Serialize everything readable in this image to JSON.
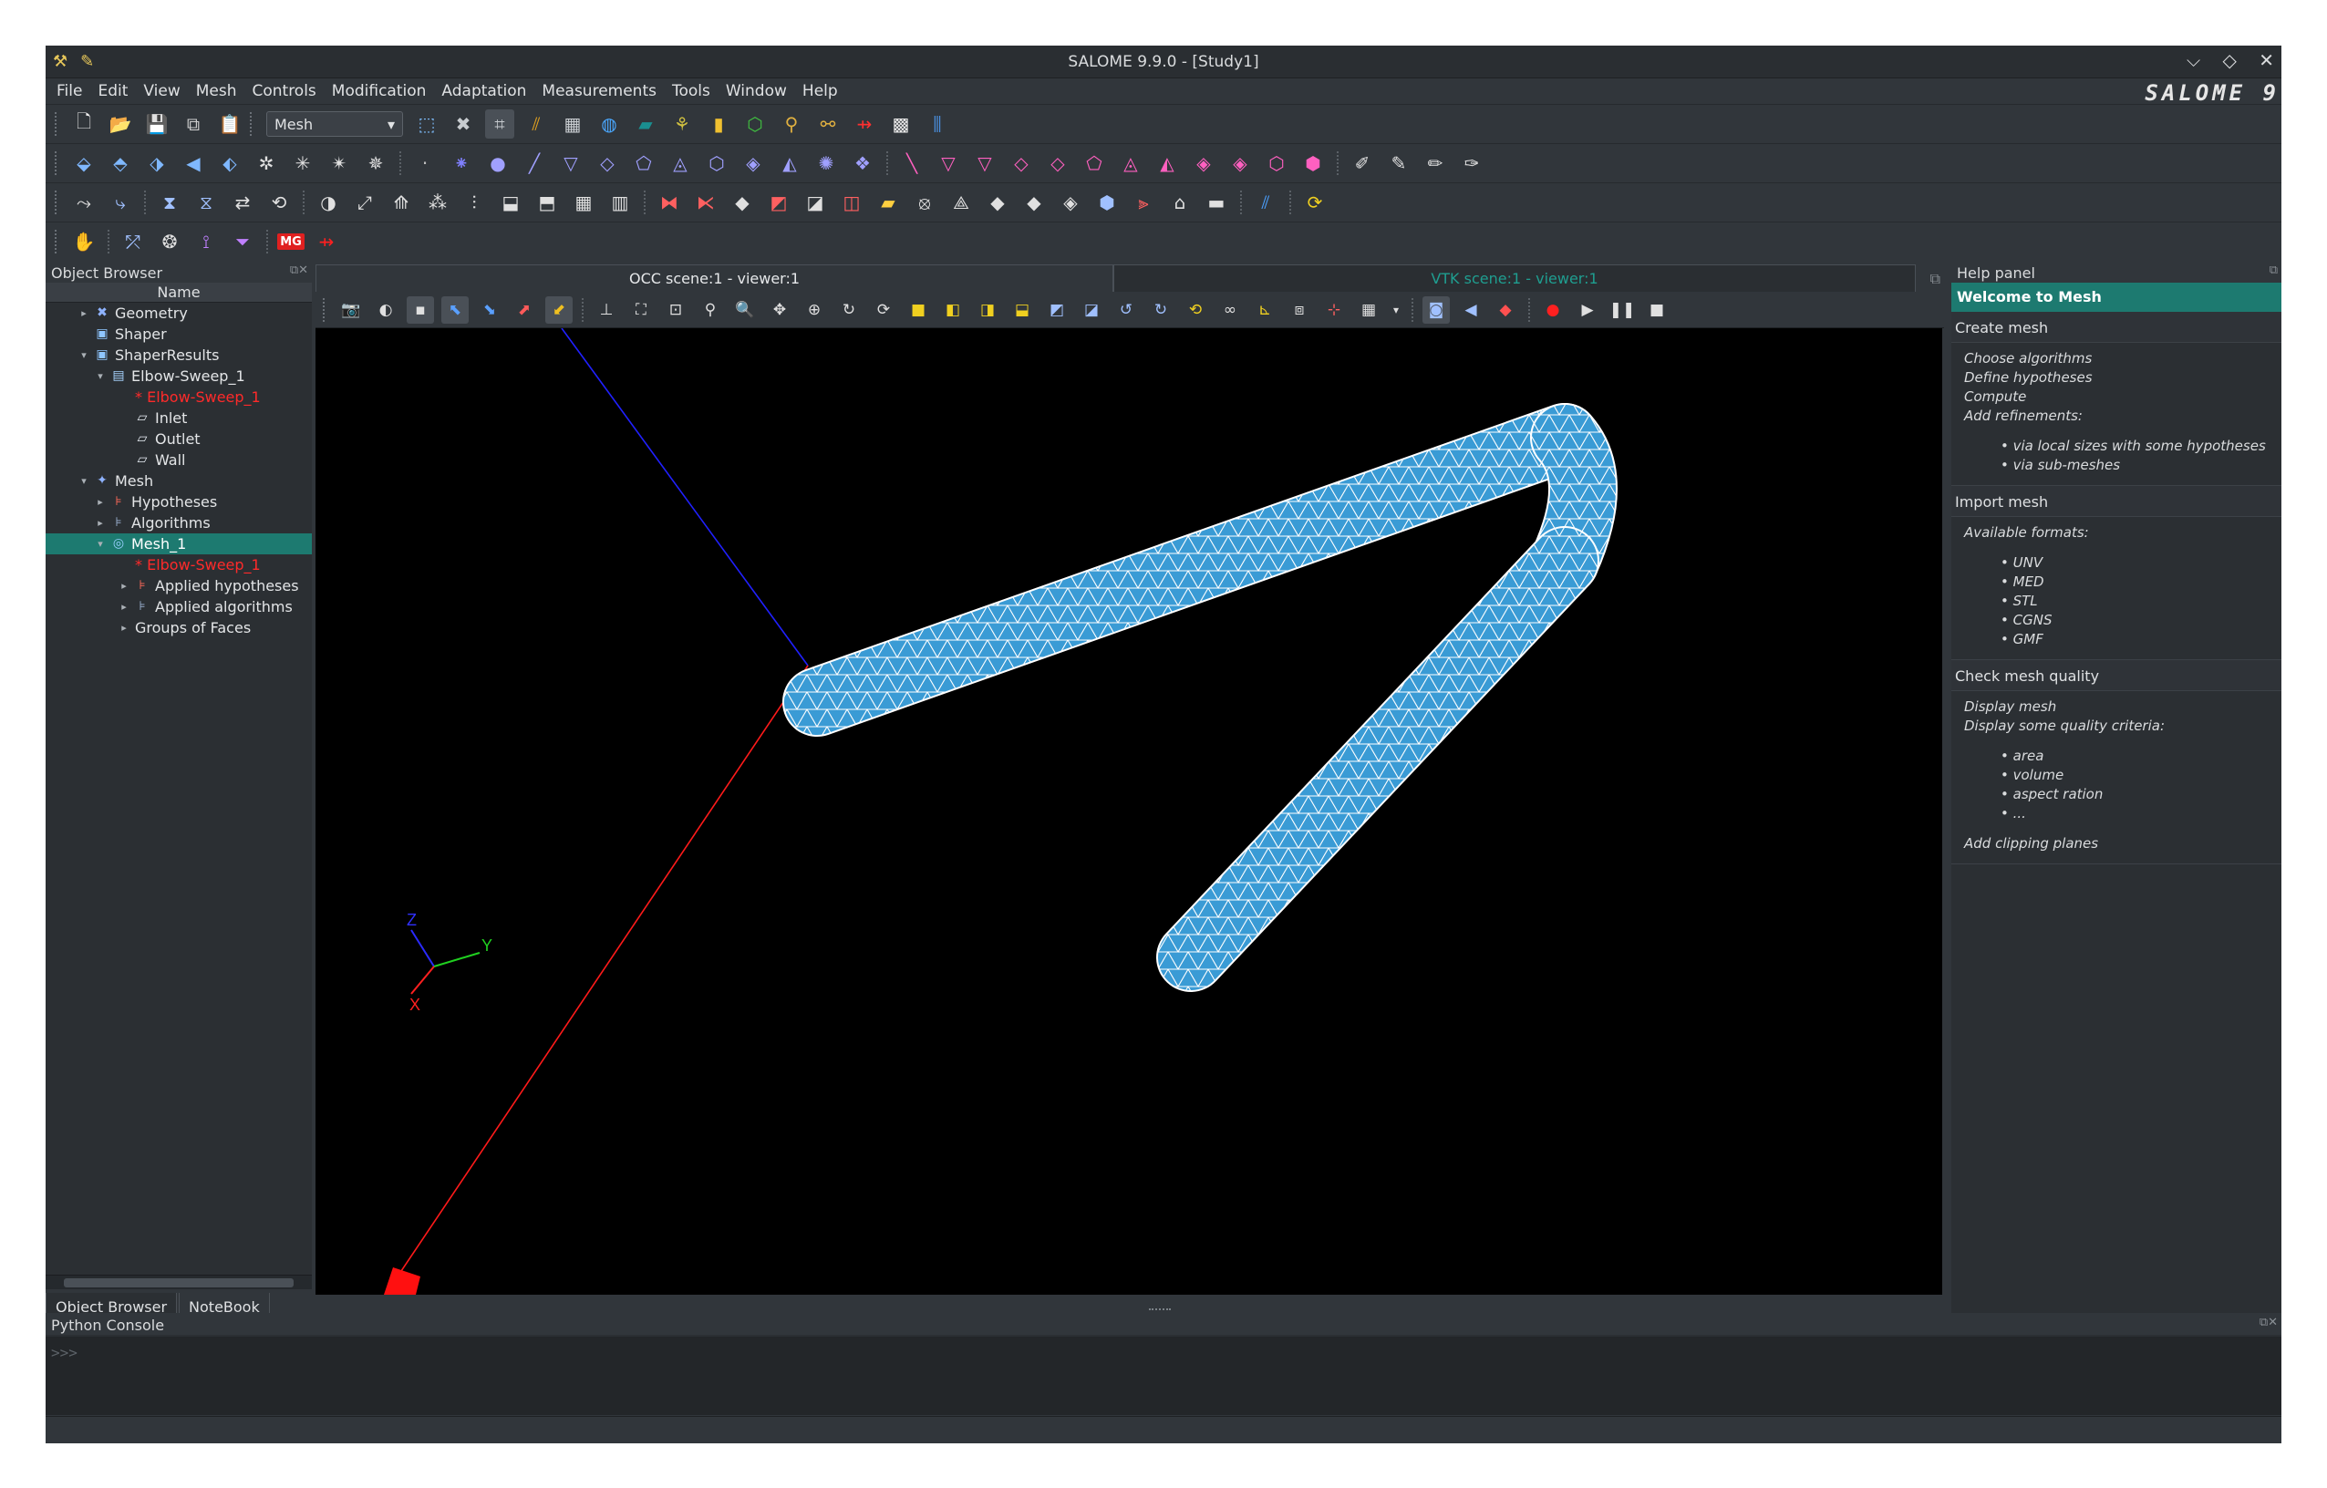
{
  "window": {
    "title": "SALOME 9.9.0 - [Study1]",
    "brand": "SALOME 9",
    "controls": [
      "⌵",
      "◇",
      "✕"
    ]
  },
  "menu": [
    "File",
    "Edit",
    "View",
    "Mesh",
    "Controls",
    "Modification",
    "Adaptation",
    "Measurements",
    "Tools",
    "Window",
    "Help"
  ],
  "toolbar": {
    "module_combo": "Mesh"
  },
  "object_browser": {
    "title": "Object Browser",
    "column_header": "Name",
    "items": [
      {
        "label": "Geometry",
        "level": 1,
        "arrow": "▸",
        "icon": "geometry-icon",
        "glyph": "✖",
        "color": "#8fb3ff"
      },
      {
        "label": "Shaper",
        "level": 1,
        "arrow": "",
        "icon": "shaper-icon",
        "glyph": "▣",
        "color": "#8fc6ff"
      },
      {
        "label": "ShaperResults",
        "level": 1,
        "arrow": "▾",
        "icon": "shaper-results-icon",
        "glyph": "▣",
        "color": "#8fc6ff"
      },
      {
        "label": "Elbow-Sweep_1",
        "level": 2,
        "arrow": "▾",
        "icon": "solid-icon",
        "glyph": "▤",
        "color": "#a8d4ff"
      },
      {
        "label": "* Elbow-Sweep_1",
        "level": 3,
        "arrow": "",
        "icon": "",
        "glyph": "",
        "color": "#ff2a2a",
        "red": true
      },
      {
        "label": "Inlet",
        "level": 3,
        "arrow": "",
        "icon": "face-icon",
        "glyph": "▱",
        "color": "#e8eef5"
      },
      {
        "label": "Outlet",
        "level": 3,
        "arrow": "",
        "icon": "face-icon",
        "glyph": "▱",
        "color": "#e8eef5"
      },
      {
        "label": "Wall",
        "level": 3,
        "arrow": "",
        "icon": "face-icon",
        "glyph": "▱",
        "color": "#e8eef5"
      },
      {
        "label": "Mesh",
        "level": 1,
        "arrow": "▾",
        "icon": "mesh-module-icon",
        "glyph": "✦",
        "color": "#8fb3ff"
      },
      {
        "label": "Hypotheses",
        "level": 2,
        "arrow": "▸",
        "icon": "hypotheses-icon",
        "glyph": "⊧",
        "color": "#ff6a5a"
      },
      {
        "label": "Algorithms",
        "level": 2,
        "arrow": "▸",
        "icon": "algorithms-icon",
        "glyph": "⊧",
        "color": "#9ab0d0"
      },
      {
        "label": "Mesh_1",
        "level": 2,
        "arrow": "▾",
        "icon": "mesh-icon",
        "glyph": "◎",
        "color": "#9ad0ff",
        "selected": true
      },
      {
        "label": "* Elbow-Sweep_1",
        "level": 3,
        "arrow": "",
        "icon": "",
        "glyph": "",
        "color": "#ff2a2a",
        "red": true
      },
      {
        "label": "Applied hypotheses",
        "level": 3,
        "arrow": "▸",
        "icon": "hypotheses-icon",
        "glyph": "⊧",
        "color": "#ff6a5a"
      },
      {
        "label": "Applied algorithms",
        "level": 3,
        "arrow": "▸",
        "icon": "algorithms-icon",
        "glyph": "⊧",
        "color": "#9ab0d0"
      },
      {
        "label": "Groups of Faces",
        "level": 3,
        "arrow": "▸",
        "icon": "",
        "glyph": "",
        "color": "#e3e5e7"
      }
    ],
    "tabs": [
      "Object Browser",
      "NoteBook"
    ]
  },
  "viewer": {
    "tabs": [
      "OCC scene:1 - viewer:1",
      "VTK scene:1 - viewer:1"
    ],
    "triad": {
      "x": "X",
      "y": "Y",
      "z": "Z"
    }
  },
  "help_panel": {
    "title": "Help panel",
    "welcome": "Welcome to Mesh",
    "sections": [
      {
        "heading": "Create mesh",
        "lines": [
          "Choose algorithms",
          "Define hypotheses",
          "Compute",
          "Add refinements:"
        ],
        "bullets": [
          "via local sizes with some hypotheses",
          "via sub-meshes"
        ],
        "tail": ""
      },
      {
        "heading": "Import mesh",
        "lines": [
          "Available formats:"
        ],
        "bullets": [
          "UNV",
          "MED",
          "STL",
          "CGNS",
          "GMF"
        ],
        "tail": ""
      },
      {
        "heading": "Check mesh quality",
        "lines": [
          "Display mesh",
          "Display some quality criteria:"
        ],
        "bullets": [
          "area",
          "volume",
          "aspect ration",
          "..."
        ],
        "tail": "Add clipping planes"
      }
    ]
  },
  "python_console": {
    "title": "Python Console",
    "prompt": ">>>"
  },
  "colors": {
    "accent": "#1d7a70",
    "mesh_fill": "#3a9bd5",
    "mesh_edges": "#ffffff",
    "axis_x": "#ff2020",
    "axis_y": "#20d020",
    "axis_z": "#3030ff"
  }
}
